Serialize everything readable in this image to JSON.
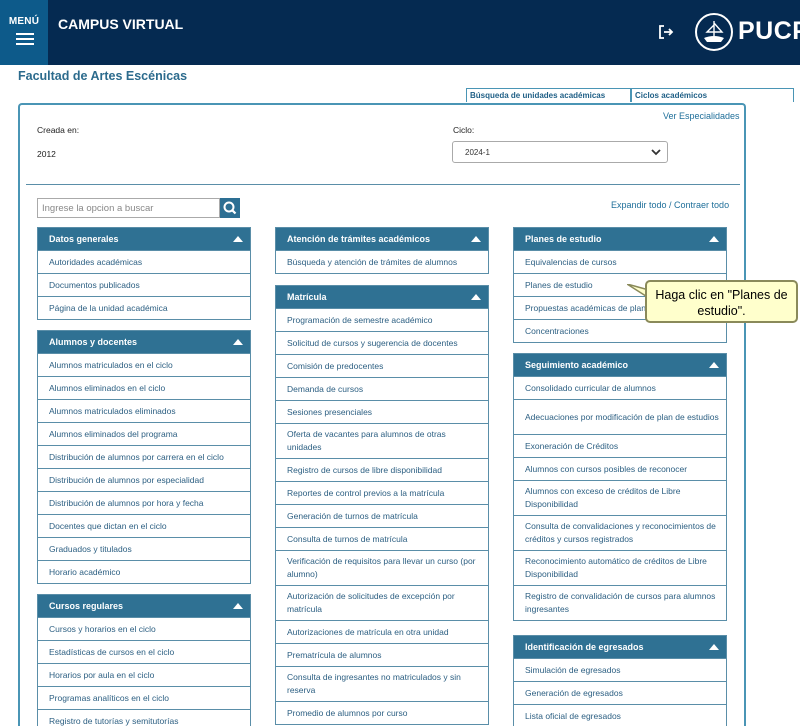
{
  "header": {
    "menu_label": "MENÚ",
    "app_title": "CAMPUS VIRTUAL",
    "logo_text": "PUCP"
  },
  "page": {
    "title": "Facultad de Artes Escénicas",
    "tabs": [
      "Búsqueda de unidades académicas",
      "Ciclos académicos"
    ],
    "ver_especialidades": "Ver Especialidades",
    "creada_label": "Creada en:",
    "creada_value": "2012",
    "ciclo_label": "Ciclo:",
    "ciclo_value": "2024-1",
    "search_placeholder": "Ingrese la opcion a buscar",
    "expand_links": "Expandir todo / Contraer todo"
  },
  "panels": {
    "datos_generales": {
      "title": "Datos generales",
      "items": [
        "Autoridades académicas",
        "Documentos publicados",
        "Página de la unidad académica"
      ]
    },
    "alumnos_docentes": {
      "title": "Alumnos y docentes",
      "items": [
        "Alumnos matriculados en el ciclo",
        "Alumnos eliminados en el ciclo",
        "Alumnos matriculados eliminados",
        "Alumnos eliminados del programa",
        "Distribución de alumnos por carrera en el ciclo",
        "Distribución de alumnos por especialidad",
        "Distribución de alumnos por hora y fecha",
        "Docentes que dictan en el ciclo",
        "Graduados y titulados",
        "Horario académico"
      ]
    },
    "cursos_regulares": {
      "title": "Cursos regulares",
      "items": [
        "Cursos y horarios en el ciclo",
        "Estadísticas de cursos en el ciclo",
        "Horarios por aula en el ciclo",
        "Programas analíticos en el ciclo",
        "Registro de tutorías y semitutorías"
      ]
    },
    "atencion_tramites": {
      "title": "Atención de trámites académicos",
      "items": [
        "Búsqueda y atención de trámites de alumnos"
      ]
    },
    "matricula": {
      "title": "Matrícula",
      "items": [
        "Programación de semestre académico",
        "Solicitud de cursos y sugerencia de docentes",
        "Comisión de predocentes",
        "Demanda de cursos",
        "Sesiones presenciales",
        "Oferta de vacantes para alumnos de otras unidades",
        "Registro de cursos de libre disponibilidad",
        "Reportes de control previos a la matrícula",
        "Generación de turnos de matrícula",
        "Consulta de turnos de matrícula",
        "Verificación de requisitos para llevar un curso (por alumno)",
        "Autorización de solicitudes de excepción por matrícula",
        "Autorizaciones de matrícula en otra unidad",
        "Prematrícula de alumnos",
        "Consulta de ingresantes no matriculados y sin reserva",
        "Promedio de alumnos por curso"
      ]
    },
    "planes_estudio": {
      "title": "Planes de estudio",
      "items": [
        "Equivalencias de cursos",
        "Planes de estudio",
        "Propuestas académicas de plan de estudio",
        "Concentraciones"
      ]
    },
    "seguimiento": {
      "title": "Seguimiento académico",
      "items": [
        "Consolidado curricular de alumnos",
        "Adecuaciones por modificación de plan de estudios",
        "Exoneración de Créditos",
        "Alumnos con cursos posibles de reconocer",
        "Alumnos con exceso de créditos de Libre Disponibilidad",
        "Consulta de convalidaciones y reconocimientos de créditos y cursos registrados",
        "Reconocimiento automático de créditos de Libre Disponibilidad",
        "Registro de convalidación de cursos para alumnos ingresantes"
      ]
    },
    "egresados": {
      "title": "Identificación de egresados",
      "items": [
        "Simulación de egresados",
        "Generación de egresados",
        "Lista oficial de egresados"
      ]
    }
  },
  "tooltip": {
    "text": "Haga clic en \"Planes de estudio\"."
  },
  "colors": {
    "header_bg": "#052a51",
    "menu_bg": "#0d5a8a",
    "panel_header": "#2f7193",
    "link": "#2c5f82",
    "tooltip_bg": "#ffffcc"
  }
}
